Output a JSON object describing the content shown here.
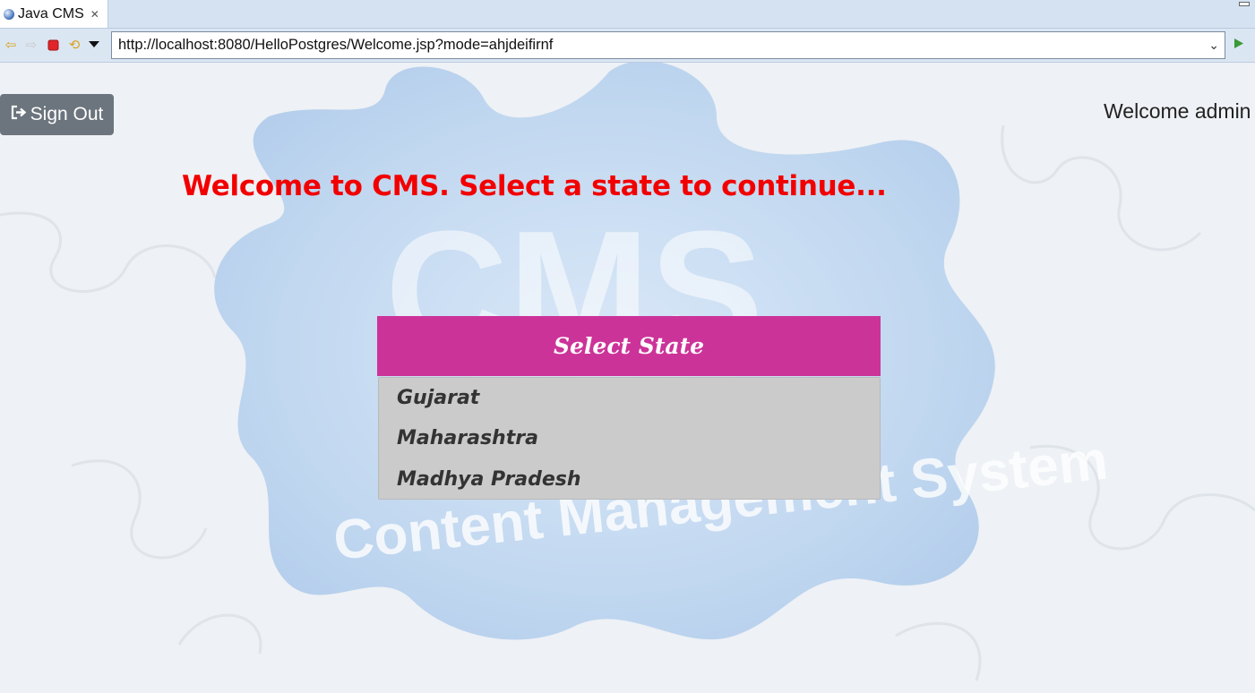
{
  "browser": {
    "tab_title": "Java CMS",
    "url": "http://localhost:8080/HelloPostgres/Welcome.jsp?mode=ahjdeifirnf"
  },
  "page": {
    "signout_label": "Sign Out",
    "welcome_user": "Welcome admin",
    "headline": "Welcome to CMS. Select a state to continue...",
    "state_header": "Select State",
    "states": [
      "Gujarat",
      "Maharashtra",
      "Madhya Pradesh"
    ],
    "background_text": {
      "logo": "CMS",
      "tagline": "Content Management System"
    }
  },
  "colors": {
    "headline": "#f20000",
    "state_header_bg": "#cc3399",
    "state_list_bg": "#cbcbcb",
    "signout_bg": "#6c757d"
  }
}
